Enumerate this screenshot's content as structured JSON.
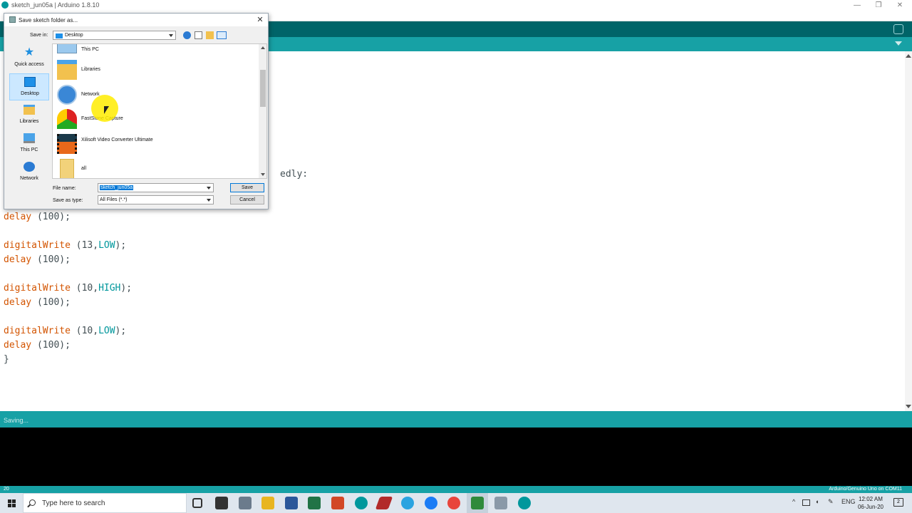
{
  "window": {
    "title": "sketch_jun05a | Arduino 1.8.10",
    "minimize": "—",
    "restore": "❐",
    "close": "✕"
  },
  "editor": {
    "lines": [
      {
        "fn": "delay",
        "args": " (100);"
      },
      {
        "fn": "",
        "args": ""
      },
      {
        "fn": "digitalWrite",
        "args": " (13,",
        "const": "LOW",
        "tail": ");"
      },
      {
        "fn": "delay",
        "args": " (100);"
      },
      {
        "fn": "",
        "args": ""
      },
      {
        "fn": "digitalWrite",
        "args": " (10,",
        "const": "HIGH",
        "tail": ");"
      },
      {
        "fn": "delay",
        "args": " (100);"
      },
      {
        "fn": "",
        "args": ""
      },
      {
        "fn": "digitalWrite",
        "args": " (10,",
        "const": "LOW",
        "tail": ");"
      },
      {
        "fn": "delay",
        "args": " (100);"
      },
      {
        "fn": "}",
        "args": ""
      }
    ],
    "partial_comment": "edly:"
  },
  "status": {
    "message": "Saving...",
    "line_number": "20",
    "board": "Arduino/Genuino Uno on COM11"
  },
  "dialog": {
    "title": "Save sketch folder as...",
    "save_in_label": "Save in:",
    "save_in_value": "Desktop",
    "places": [
      {
        "label": "Quick access",
        "icon": "star-icon"
      },
      {
        "label": "Desktop",
        "icon": "desktop-icon"
      },
      {
        "label": "Libraries",
        "icon": "libraries-icon"
      },
      {
        "label": "This PC",
        "icon": "computer-icon"
      },
      {
        "label": "Network",
        "icon": "network-icon"
      }
    ],
    "files": [
      {
        "label": "This PC",
        "icon": "computer-icon"
      },
      {
        "label": "Libraries",
        "icon": "libraries-folder-icon"
      },
      {
        "label": "Network",
        "icon": "network-icon"
      },
      {
        "label": "FastStone Capture",
        "icon": "faststone-icon"
      },
      {
        "label": "Xilisoft Video Converter Ultimate",
        "icon": "film-icon"
      },
      {
        "label": "all",
        "icon": "folder-icon"
      }
    ],
    "file_name_label": "File name:",
    "file_name_value": "sketch_jun05a",
    "save_as_type_label": "Save as type:",
    "save_as_type_value": "All Files (*.*)",
    "save_button": "Save",
    "cancel_button": "Cancel"
  },
  "taskbar": {
    "search_placeholder": "Type here to search",
    "language": "ENG",
    "time": "12:02 AM",
    "date": "06-Jun-20",
    "notification_count": "2"
  },
  "colors": {
    "arduino_teal": "#17a1a5",
    "arduino_dark_teal": "#006468",
    "keyword_orange": "#d35400",
    "constant_teal": "#00979c"
  }
}
